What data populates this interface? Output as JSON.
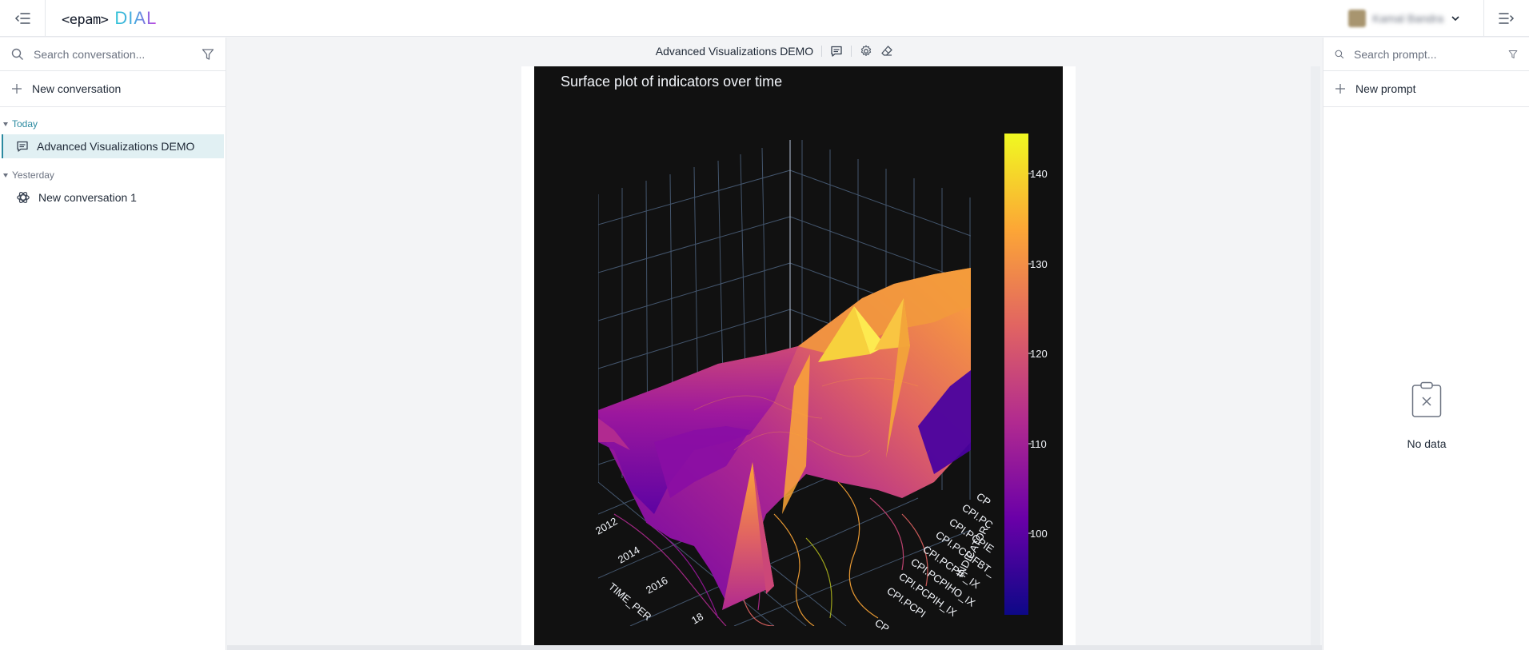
{
  "header": {
    "logo_left": "<epam>",
    "logo_right": "DIAL",
    "user_name": "Kamal Bandra",
    "menu_icon": "menu-collapse-icon",
    "right_icon": "menu-expand-icon"
  },
  "left_panel": {
    "search_placeholder": "Search conversation...",
    "new_conversation_label": "New conversation",
    "sections": [
      {
        "title": "Today",
        "items": [
          {
            "label": "Advanced Visualizations DEMO",
            "icon": "chat-bubble-icon",
            "active": true
          }
        ]
      },
      {
        "title": "Yesterday",
        "items": [
          {
            "label": "New conversation 1",
            "icon": "openai-icon",
            "active": false
          }
        ]
      }
    ]
  },
  "conversation": {
    "title": "Advanced Visualizations DEMO",
    "actions": [
      "chat-bubble-icon",
      "settings-icon",
      "eraser-icon"
    ]
  },
  "chart_data": {
    "type": "surface",
    "title": "Surface plot of indicators over time",
    "colorscale": "plasma",
    "colorbar": {
      "range": [
        92,
        144
      ],
      "ticks": [
        100,
        110,
        120,
        130,
        140
      ]
    },
    "x_axis": {
      "label": "TIME_PER",
      "ticks": [
        "2012",
        "2014",
        "2016",
        "18"
      ]
    },
    "y_axis": {
      "label": "INDICATOR",
      "ticks": [
        "CP",
        "CPI.PC",
        "CPI.PCPIE",
        "CPI.PCPIFBT_",
        "CPI.PCPIF_IX",
        "CPI.PCPIHO_IX",
        "CPI.PCPIH_IX",
        "CPI.PCPI",
        "CP"
      ]
    },
    "background": "#111111"
  },
  "right_panel": {
    "search_placeholder": "Search prompt...",
    "new_prompt_label": "New prompt",
    "empty_text": "No data"
  }
}
